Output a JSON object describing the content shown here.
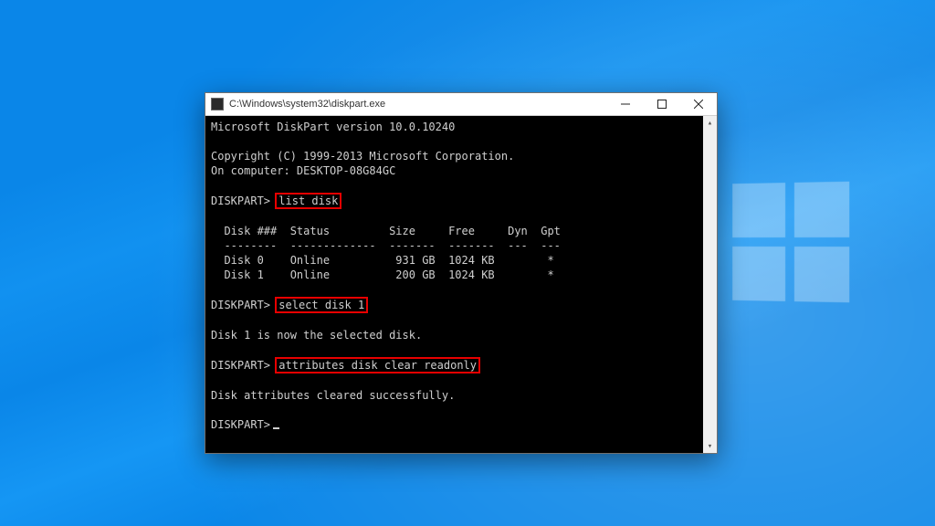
{
  "colors": {
    "highlight_border": "#e80000",
    "console_fg": "#cfcfcf",
    "console_bg": "#000000",
    "wallpaper": "#0a86e8"
  },
  "window": {
    "title": "C:\\Windows\\system32\\diskpart.exe"
  },
  "console": {
    "version_line": "Microsoft DiskPart version 10.0.10240",
    "copyright_line": "Copyright (C) 1999-2013 Microsoft Corporation.",
    "computer_line": "On computer: DESKTOP-08G84GC",
    "prompt": "DISKPART>",
    "cmd_list_disk": "list disk",
    "table_header": "  Disk ###  Status         Size     Free     Dyn  Gpt",
    "table_divider": "  --------  -------------  -------  -------  ---  ---",
    "table_row_0": "  Disk 0    Online          931 GB  1024 KB        *",
    "table_row_1": "  Disk 1    Online          200 GB  1024 KB        *",
    "cmd_select_disk": "select disk 1",
    "resp_select": "Disk 1 is now the selected disk.",
    "cmd_attr_clear": "attributes disk clear readonly",
    "resp_attr": "Disk attributes cleared successfully.",
    "disks": [
      {
        "index": 0,
        "status": "Online",
        "size": "931 GB",
        "free": "1024 KB",
        "dyn": "",
        "gpt": "*"
      },
      {
        "index": 1,
        "status": "Online",
        "size": "200 GB",
        "free": "1024 KB",
        "dyn": "",
        "gpt": "*"
      }
    ]
  }
}
